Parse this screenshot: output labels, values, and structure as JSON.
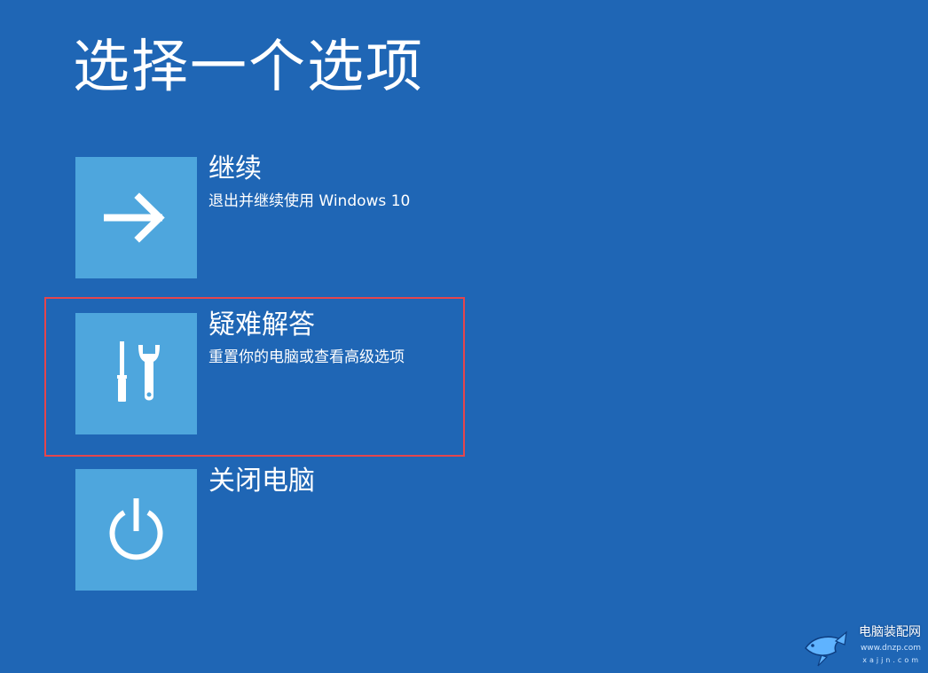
{
  "page": {
    "title": "选择一个选项"
  },
  "options": [
    {
      "id": "continue",
      "label": "继续",
      "description": "退出并继续使用 Windows 10",
      "icon": "arrow-right-icon"
    },
    {
      "id": "troubleshoot",
      "label": "疑难解答",
      "description": "重置你的电脑或查看高级选项",
      "icon": "tools-icon",
      "highlighted": true
    },
    {
      "id": "shutdown",
      "label": "关闭电脑",
      "description": "",
      "icon": "power-icon"
    }
  ],
  "watermark": {
    "text": "电脑装配网",
    "url": "www.dnzp.com",
    "url2": "xajjn.com"
  },
  "colors": {
    "background": "#1f66b5",
    "tile": "#4ea6dd",
    "highlight": "#e5454c",
    "text": "#ffffff"
  }
}
